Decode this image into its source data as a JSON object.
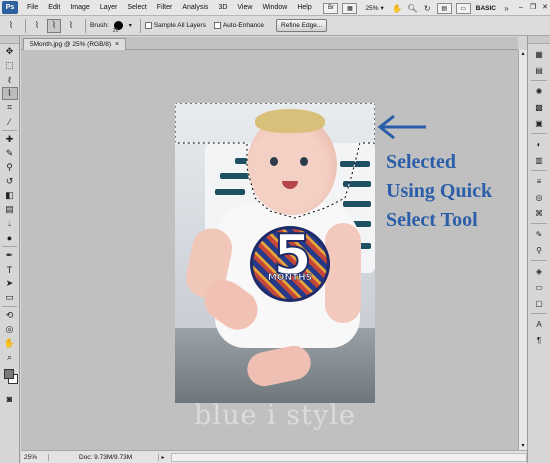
{
  "menubar": {
    "logo": "Ps",
    "items": [
      "File",
      "Edit",
      "Image",
      "Layer",
      "Select",
      "Filter",
      "Analysis",
      "3D",
      "View",
      "Window",
      "Help"
    ],
    "zoom": "25%",
    "workspace": "BASIC"
  },
  "options": {
    "brush_label": "Brush:",
    "brush_size": "20",
    "sample_all_layers": "Sample All Layers",
    "auto_enhance": "Auto-Enhance",
    "refine_edge": "Refine Edge..."
  },
  "document": {
    "tab_title": "5Month.jpg @ 25% (RGB/8)",
    "status_zoom": "25%",
    "status_doc": "Doc: 9.73M/9.73M"
  },
  "photo": {
    "sticker_number": "5",
    "sticker_text": "MONTHS",
    "watermark": "blue i style"
  },
  "annotation": {
    "line1": "Selected",
    "line2": "Using Quick",
    "line3": "Select Tool",
    "color": "#2a5ea8"
  }
}
